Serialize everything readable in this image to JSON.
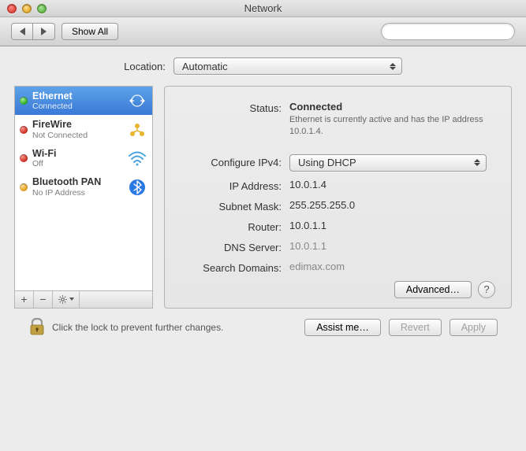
{
  "window": {
    "title": "Network"
  },
  "toolbar": {
    "show_all": "Show All",
    "search_placeholder": ""
  },
  "location": {
    "label": "Location:",
    "value": "Automatic"
  },
  "sidebar": {
    "items": [
      {
        "name": "Ethernet",
        "status": "Connected",
        "dot": "green",
        "selected": true,
        "icon": "ethernet"
      },
      {
        "name": "FireWire",
        "status": "Not Connected",
        "dot": "red",
        "selected": false,
        "icon": "firewire"
      },
      {
        "name": "Wi-Fi",
        "status": "Off",
        "dot": "red",
        "selected": false,
        "icon": "wifi"
      },
      {
        "name": "Bluetooth PAN",
        "status": "No IP Address",
        "dot": "amber",
        "selected": false,
        "icon": "bluetooth"
      }
    ]
  },
  "detail": {
    "status_label": "Status:",
    "status_value": "Connected",
    "status_desc": "Ethernet is currently active and has the IP address 10.0.1.4.",
    "configure_label": "Configure IPv4:",
    "configure_value": "Using DHCP",
    "ip_label": "IP Address:",
    "ip_value": "10.0.1.4",
    "subnet_label": "Subnet Mask:",
    "subnet_value": "255.255.255.0",
    "router_label": "Router:",
    "router_value": "10.0.1.1",
    "dns_label": "DNS Server:",
    "dns_value": "10.0.1.1",
    "search_label": "Search Domains:",
    "search_value": "edimax.com",
    "advanced": "Advanced…"
  },
  "footer": {
    "lock_text": "Click the lock to prevent further changes.",
    "assist": "Assist me…",
    "revert": "Revert",
    "apply": "Apply"
  }
}
